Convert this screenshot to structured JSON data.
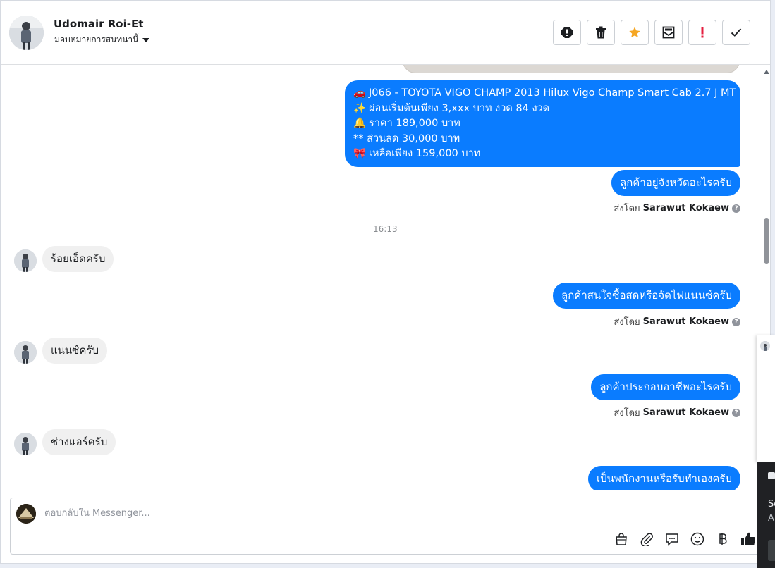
{
  "header": {
    "contact_name": "Udomair Roi-Et",
    "assign_label": "มอบหมายการสนทนานี้",
    "actions": [
      {
        "name": "spam-icon"
      },
      {
        "name": "trash-icon"
      },
      {
        "name": "star-icon",
        "color": "#f5a623"
      },
      {
        "name": "mark-unread-icon"
      },
      {
        "name": "follow-up-icon",
        "color": "#e41e3f"
      },
      {
        "name": "done-check-icon"
      }
    ]
  },
  "messages": {
    "listing": {
      "lines": [
        {
          "emoji": "🚗",
          "text": "J066 - TOYOTA VIGO CHAMP 2013 Hilux Vigo Champ Smart Cab 2.7 J MT"
        },
        {
          "emoji": "✨",
          "text": "ผ่อนเริ่มต้นเพียง 3,xxx บาท งวด 84 งวด"
        },
        {
          "emoji": "🔔",
          "text": "ราคา 189,000 บาท"
        },
        {
          "emoji": "",
          "text": "** ส่วนลด 30,000 บาท"
        },
        {
          "emoji": "🎀",
          "text": "เหลือเพียง 159,000 บาท"
        }
      ]
    },
    "out1": "ลูกค้าอยู่จังหวัดอะไรครับ",
    "sent_by_prefix": "ส่งโดย",
    "sent_by_name": "Sarawut Kokaew",
    "timestamp": "16:13",
    "in1": "ร้อยเอ็ดครับ",
    "out2": "ลูกค้าสนใจซื้อสดหรือจัดไฟแนนซ์ครับ",
    "in2": "แนนซ์ครับ",
    "out3": "ลูกค้าประกอบอาชีพอะไรครับ",
    "in3": "ช่างแอร์ครับ",
    "out4": "เป็นพนักงานหรือรับทำเองครับ"
  },
  "composer": {
    "placeholder": "ตอบกลับใน Messenger...",
    "tools": [
      "shop-bag-icon",
      "paperclip-icon",
      "saved-reply-icon",
      "emoji-icon",
      "baht-icon",
      "thumbs-up-icon"
    ]
  },
  "side_overlay": {
    "line1": "Sc",
    "line2": "A"
  },
  "colors": {
    "accent": "#0a7cff",
    "incoming": "#f0f0f0"
  }
}
